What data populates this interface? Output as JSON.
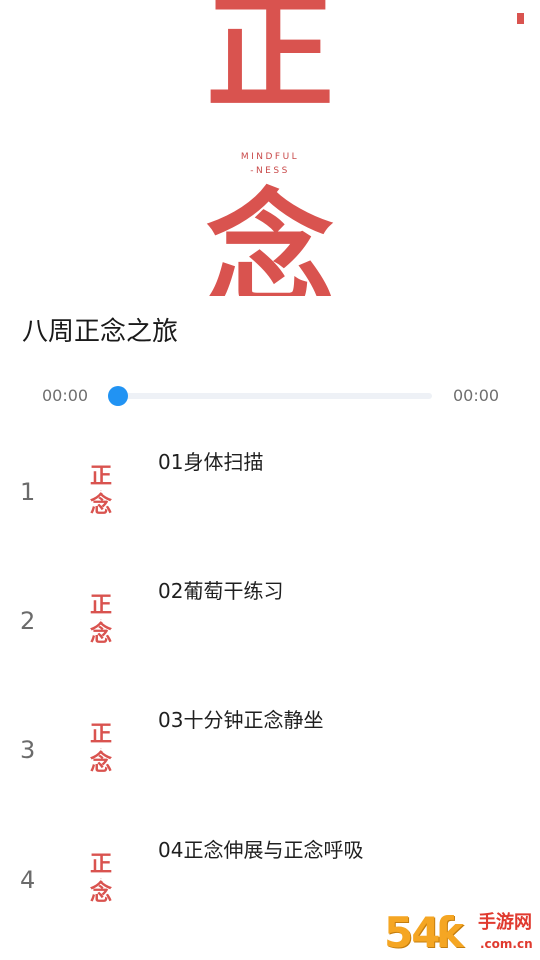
{
  "cover": {
    "char_top": "正",
    "char_bottom": "念",
    "sub_line_1": "MINDFUL",
    "sub_line_2": "-NESS",
    "accent_color": "#d9534f"
  },
  "album": {
    "title": "八周正念之旅"
  },
  "player": {
    "current_time": "00:00",
    "total_time": "00:00",
    "progress": 0,
    "thumb_color": "#2193f3"
  },
  "tracks": [
    {
      "index": "1",
      "title": "01身体扫描",
      "art_top": "正",
      "art_bottom": "念"
    },
    {
      "index": "2",
      "title": "02葡萄干练习",
      "art_top": "正",
      "art_bottom": "念"
    },
    {
      "index": "3",
      "title": "03十分钟正念静坐",
      "art_top": "正",
      "art_bottom": "念"
    },
    {
      "index": "4",
      "title": "04正念伸展与正念呼吸",
      "art_top": "正",
      "art_bottom": "念"
    }
  ],
  "watermark": {
    "number": "54",
    "glyph": "ƙ",
    "name": "手游网",
    "domain": ".com.cn"
  }
}
